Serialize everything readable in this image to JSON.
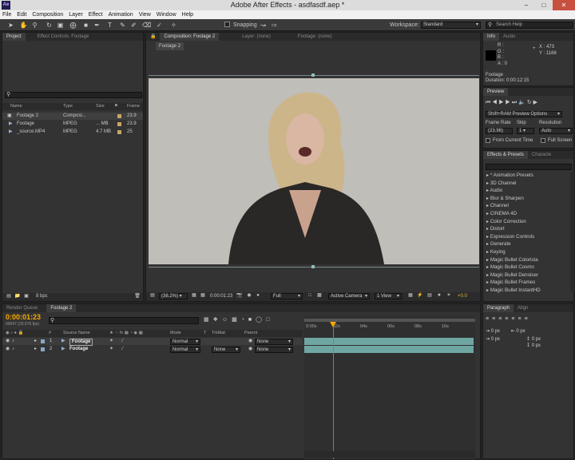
{
  "app": {
    "title": "Adobe After Effects - asdfasdf.aep *",
    "logo_text": "Ae",
    "menu": [
      "File",
      "Edit",
      "Composition",
      "Layer",
      "Effect",
      "Animation",
      "View",
      "Window",
      "Help"
    ]
  },
  "toolbar": {
    "snapping_label": "Snapping",
    "workspace_label": "Workspace:",
    "workspace_value": "Standard",
    "search_help_placeholder": "Search Help"
  },
  "project": {
    "tab_project": "Project",
    "tab_effect_controls": "Effect Controls: Footage",
    "columns": [
      "Name",
      "Type",
      "Size",
      "Frame ..."
    ],
    "items": [
      {
        "name": "Footage 2",
        "type": "Composi...",
        "size": "",
        "fps": "23.9"
      },
      {
        "name": "Footage",
        "type": "MPEG",
        "size": "... MB",
        "fps": "23.9"
      },
      {
        "name": "_source.MP4",
        "type": "MPEG",
        "size": "4.7 MB",
        "fps": "25"
      }
    ],
    "bpc": "8 bpc"
  },
  "comp": {
    "tab_comp": "Composition: Footage 2",
    "tab_layer": "Layer: (none)",
    "tab_footage": "Footage: (none)",
    "breadcrumb": "Footage 2",
    "zoom": "(38.2%)",
    "timecode": "0:00:01:23",
    "resolution": "Full",
    "camera": "Active Camera",
    "views": "1 View",
    "exposure": "+0.0"
  },
  "info": {
    "tab_info": "Info",
    "tab_audio": "Audio",
    "rgba": [
      "R :",
      "G :",
      "B :",
      "A : 0"
    ],
    "x": "X : 473",
    "y": "Y : 1166",
    "name": "Footage",
    "duration": "Duration: 0:00:12:15"
  },
  "preview": {
    "tab": "Preview",
    "options": "Shift+RAM Preview Options",
    "frame_rate_label": "Frame Rate",
    "skip_label": "Skip",
    "resolution_label": "Resolution",
    "frame_rate_value": "(23.98)",
    "skip_value": "1",
    "resolution_value": "Auto",
    "from_current": "From Current Time",
    "full_screen": "Full Screen"
  },
  "effects": {
    "tab": "Effects & Presets",
    "tab2": "Characte",
    "items": [
      "* Animation Presets",
      "3D Channel",
      "Audio",
      "Blur & Sharpen",
      "Channel",
      "CINEMA 4D",
      "Color Correction",
      "Distort",
      "Expression Controls",
      "Generate",
      "Keying",
      "Magic Bullet Colorista",
      "Magic Bullet Cosmo",
      "Magic Bullet Denoiser",
      "Magic Bullet Frames",
      "Magic Bullet InstantHD"
    ]
  },
  "paragraph": {
    "tab": "Paragraph",
    "tab2": "Align",
    "px": [
      "0 px",
      "0 px",
      "0 px",
      "0 px",
      "0 px"
    ]
  },
  "timeline": {
    "tab_render": "Render Queue",
    "tab_comp": "Footage 2",
    "timecode": "0:00:01:23",
    "frames": "00047 (23.976 fps)",
    "col_source": "Source Name",
    "col_mode": "Mode",
    "col_t": "T",
    "col_trkmat": "TrkMat",
    "col_parent": "Parent",
    "col_num": "#",
    "ruler": [
      "0:00s",
      "02s",
      "04s",
      "06s",
      "08s",
      "10s"
    ],
    "layers": [
      {
        "num": "1",
        "name": "Footage",
        "mode": "Normal",
        "trkmat": "",
        "parent": "None"
      },
      {
        "num": "2",
        "name": "Footage",
        "mode": "Normal",
        "trkmat": "None",
        "parent": "None"
      }
    ]
  },
  "colors": {
    "accent": "#f7a800",
    "teal": "#6fa6a2",
    "playhead": "#e05a3a"
  }
}
